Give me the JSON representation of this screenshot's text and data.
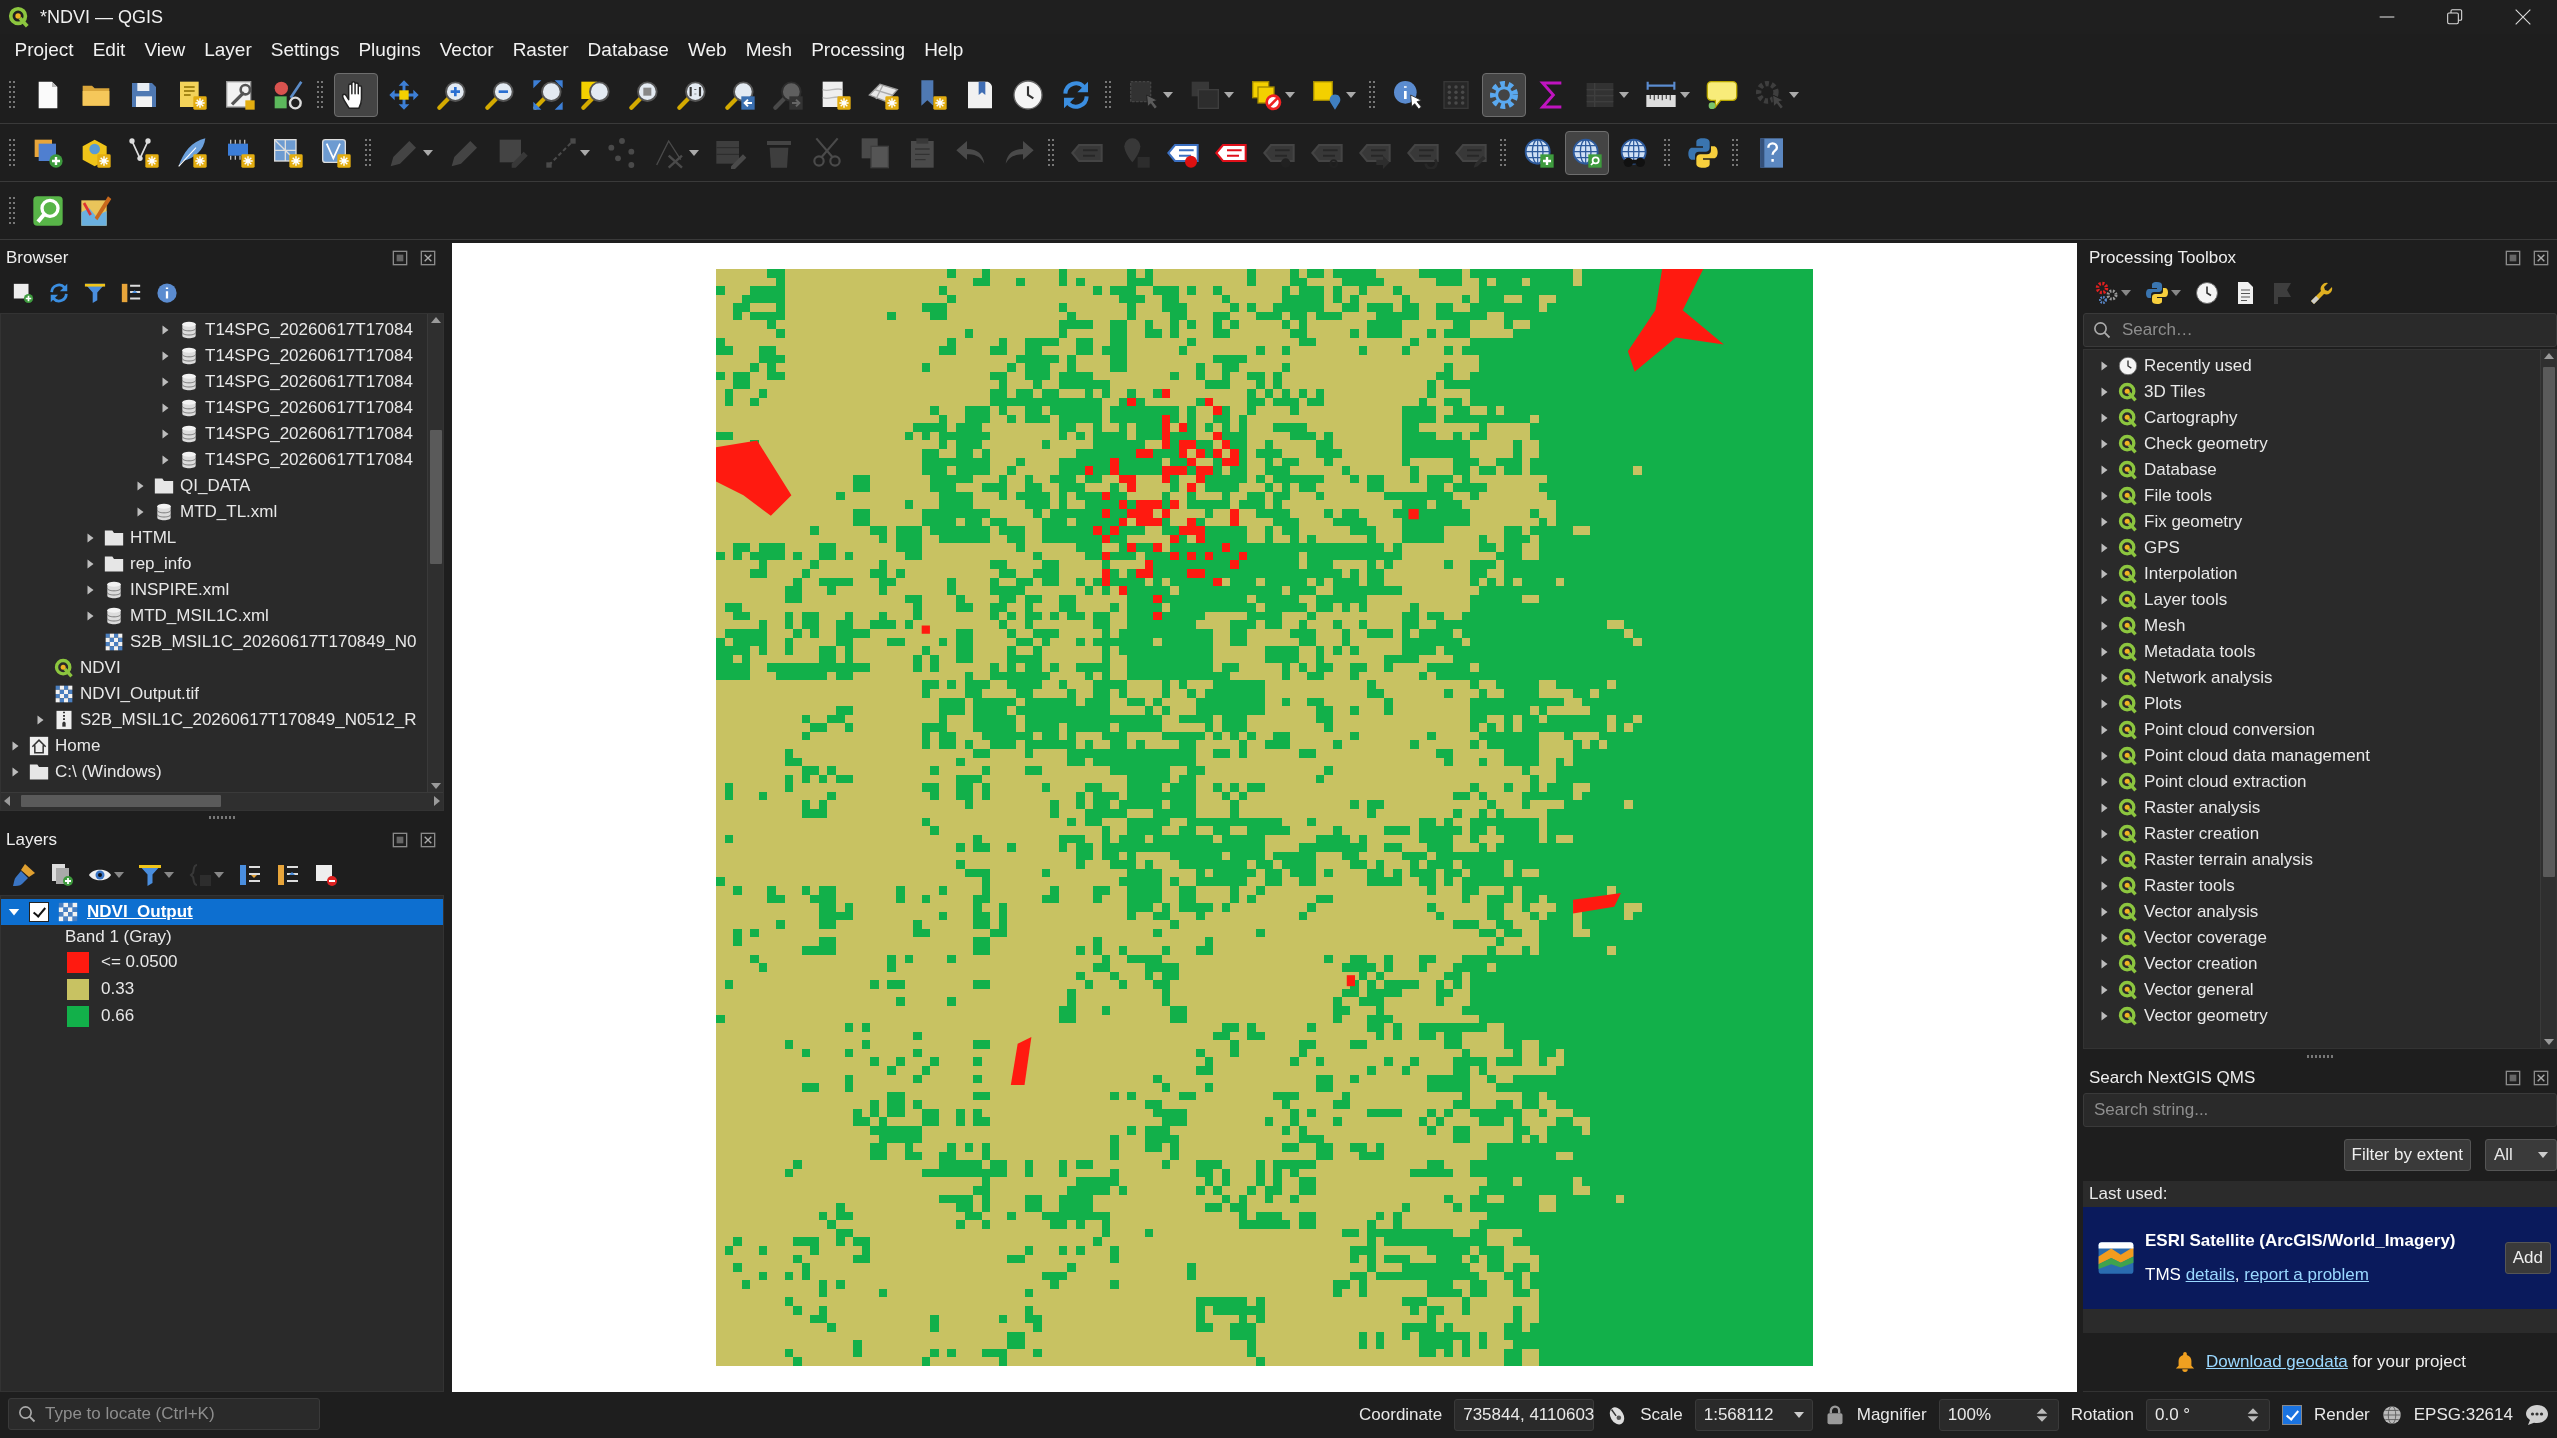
{
  "window": {
    "title": "*NDVI — QGIS"
  },
  "menu": [
    "Project",
    "Edit",
    "View",
    "Layer",
    "Settings",
    "Plugins",
    "Vector",
    "Raster",
    "Database",
    "Web",
    "Mesh",
    "Processing",
    "Help"
  ],
  "toolbars": [
    {
      "groups": [
        [
          {
            "on": false,
            "disabled": false
          },
          {
            "on": false,
            "disabled": false
          },
          {
            "on": false,
            "disabled": false
          },
          {
            "on": false,
            "disabled": false
          },
          {
            "on": false,
            "disabled": false
          },
          {
            "on": false,
            "disabled": false
          }
        ],
        [
          {
            "on": true,
            "disabled": false
          },
          {
            "on": false,
            "disabled": false
          },
          {
            "on": false,
            "disabled": false
          },
          {
            "on": false,
            "disabled": false
          },
          {
            "on": false,
            "disabled": false
          },
          {
            "on": false,
            "disabled": false
          },
          {
            "on": false,
            "disabled": false
          },
          {
            "on": false,
            "disabled": false
          },
          {
            "on": false,
            "disabled": false
          },
          {
            "on": false,
            "disabled": true
          },
          {
            "on": false,
            "disabled": false
          },
          {
            "on": false,
            "disabled": false
          },
          {
            "on": false,
            "disabled": false
          },
          {
            "on": false,
            "disabled": false
          },
          {
            "on": false,
            "disabled": false
          },
          {
            "on": false,
            "disabled": false
          }
        ],
        [
          {
            "on": false,
            "disabled": true
          },
          {
            "on": false,
            "disabled": true
          },
          {
            "on": false,
            "disabled": false
          },
          {
            "on": false,
            "disabled": false
          }
        ],
        [
          {
            "on": false,
            "disabled": false
          },
          {
            "on": false,
            "disabled": true
          },
          {
            "on": true,
            "disabled": false
          },
          {
            "on": false,
            "disabled": false
          },
          {
            "on": false,
            "disabled": true
          },
          {
            "on": false,
            "disabled": false
          },
          {
            "on": false,
            "disabled": false
          },
          {
            "on": false,
            "disabled": true
          }
        ]
      ]
    },
    {
      "groups": [
        [
          {
            "on": false,
            "disabled": false
          },
          {
            "on": false,
            "disabled": false
          },
          {
            "on": false,
            "disabled": false
          },
          {
            "on": false,
            "disabled": false
          },
          {
            "on": false,
            "disabled": false
          },
          {
            "on": false,
            "disabled": false
          },
          {
            "on": false,
            "disabled": false
          }
        ],
        [
          {
            "on": false,
            "disabled": true
          },
          {
            "on": false,
            "disabled": true
          },
          {
            "on": false,
            "disabled": true
          },
          {
            "on": false,
            "disabled": true
          },
          {
            "on": false,
            "disabled": true
          },
          {
            "on": false,
            "disabled": true
          },
          {
            "on": false,
            "disabled": true
          },
          {
            "on": false,
            "disabled": true
          },
          {
            "on": false,
            "disabled": true
          },
          {
            "on": false,
            "disabled": true
          },
          {
            "on": false,
            "disabled": true
          },
          {
            "on": false,
            "disabled": true
          },
          {
            "on": false,
            "disabled": true
          }
        ],
        [
          {
            "on": false,
            "disabled": true
          },
          {
            "on": false,
            "disabled": true
          },
          {
            "on": false,
            "disabled": false
          },
          {
            "on": false,
            "disabled": false
          },
          {
            "on": false,
            "disabled": true
          },
          {
            "on": false,
            "disabled": true
          },
          {
            "on": false,
            "disabled": true
          },
          {
            "on": false,
            "disabled": true
          },
          {
            "on": false,
            "disabled": true
          }
        ],
        [
          {
            "on": false,
            "disabled": false
          },
          {
            "on": true,
            "disabled": false
          },
          {
            "on": false,
            "disabled": false
          }
        ],
        [
          {
            "on": false,
            "disabled": false
          }
        ],
        [
          {
            "on": false,
            "disabled": false
          }
        ]
      ]
    },
    {
      "groups": [
        [
          {
            "on": false,
            "disabled": false
          },
          {
            "on": false,
            "disabled": false
          }
        ]
      ]
    }
  ],
  "browser": {
    "title": "Browser",
    "tree": [
      {
        "children": [
          {
            "children": [
              {
                "children": [
                  {
                    "children": [
                      {
                        "children": [
                          {
                            "children": [
                              {
                                "label": "T14SPG_20260617T17084",
                                "kind": "database",
                                "expandable": true
                              },
                              {
                                "label": "T14SPG_20260617T17084",
                                "kind": "database",
                                "expandable": true
                              },
                              {
                                "label": "T14SPG_20260617T17084",
                                "kind": "database",
                                "expandable": true
                              },
                              {
                                "label": "T14SPG_20260617T17084",
                                "kind": "database",
                                "expandable": true
                              },
                              {
                                "label": "T14SPG_20260617T17084",
                                "kind": "database",
                                "expandable": true
                              },
                              {
                                "label": "T14SPG_20260617T17084",
                                "kind": "database",
                                "expandable": true
                              }
                            ]
                          },
                          {
                            "label": "QI_DATA",
                            "kind": "folder",
                            "expandable": true
                          },
                          {
                            "label": "MTD_TL.xml",
                            "kind": "database",
                            "expandable": true
                          }
                        ]
                      }
                    ]
                  },
                  {
                    "label": "HTML",
                    "kind": "folder",
                    "expandable": true
                  },
                  {
                    "label": "rep_info",
                    "kind": "folder",
                    "expandable": true
                  },
                  {
                    "label": "INSPIRE.xml",
                    "kind": "database",
                    "expandable": true
                  },
                  {
                    "label": "MTD_MSIL1C.xml",
                    "kind": "database",
                    "expandable": true
                  },
                  {
                    "label": "S2B_MSIL1C_20260617T170849_N0",
                    "kind": "raster",
                    "expandable": false
                  }
                ]
              }
            ]
          },
          {
            "label": "NDVI",
            "kind": "project",
            "expandable": false
          },
          {
            "label": "NDVI_Output.tif",
            "kind": "raster",
            "expandable": false
          },
          {
            "label": "S2B_MSIL1C_20260617T170849_N0512_R",
            "kind": "zip",
            "expandable": true
          }
        ]
      },
      {
        "label": "Home",
        "kind": "home",
        "expandable": true
      },
      {
        "label": "C:\\ (Windows)",
        "kind": "folder",
        "expandable": true
      }
    ]
  },
  "layers": {
    "title": "Layers",
    "toolbar": [
      {
        "disabled": false
      },
      {
        "disabled": false
      },
      {
        "disabled": false
      },
      {
        "disabled": false
      },
      {
        "disabled": true
      },
      {
        "disabled": false
      },
      {
        "disabled": false
      },
      {
        "disabled": false
      }
    ],
    "items": [
      {
        "label": "NDVI_Output",
        "selected": true,
        "checked": true,
        "expanded": true,
        "band": "Band 1 (Gray)",
        "legend": [
          {
            "label": "<= 0.0500",
            "color": "#ff1a10"
          },
          {
            "label": "0.33",
            "color": "#c8c262"
          },
          {
            "label": "0.66",
            "color": "#12b04a"
          }
        ]
      }
    ]
  },
  "processing": {
    "title": "Processing Toolbox",
    "toolbar": [
      {
        "disabled": false
      },
      {
        "disabled": false
      },
      {
        "disabled": false
      },
      {
        "disabled": false
      },
      {
        "disabled": true
      },
      {
        "disabled": false
      }
    ],
    "search": {
      "placeholder": "Search…"
    },
    "items": [
      {
        "label": "Recently used",
        "kind": "recent"
      },
      {
        "label": "3D Tiles",
        "kind": "provider"
      },
      {
        "label": "Cartography",
        "kind": "provider"
      },
      {
        "label": "Check geometry",
        "kind": "provider"
      },
      {
        "label": "Database",
        "kind": "provider"
      },
      {
        "label": "File tools",
        "kind": "provider"
      },
      {
        "label": "Fix geometry",
        "kind": "provider"
      },
      {
        "label": "GPS",
        "kind": "provider"
      },
      {
        "label": "Interpolation",
        "kind": "provider"
      },
      {
        "label": "Layer tools",
        "kind": "provider"
      },
      {
        "label": "Mesh",
        "kind": "provider"
      },
      {
        "label": "Metadata tools",
        "kind": "provider"
      },
      {
        "label": "Network analysis",
        "kind": "provider"
      },
      {
        "label": "Plots",
        "kind": "provider"
      },
      {
        "label": "Point cloud conversion",
        "kind": "provider"
      },
      {
        "label": "Point cloud data management",
        "kind": "provider"
      },
      {
        "label": "Point cloud extraction",
        "kind": "provider"
      },
      {
        "label": "Raster analysis",
        "kind": "provider"
      },
      {
        "label": "Raster creation",
        "kind": "provider"
      },
      {
        "label": "Raster terrain analysis",
        "kind": "provider"
      },
      {
        "label": "Raster tools",
        "kind": "provider"
      },
      {
        "label": "Vector analysis",
        "kind": "provider"
      },
      {
        "label": "Vector coverage",
        "kind": "provider"
      },
      {
        "label": "Vector creation",
        "kind": "provider"
      },
      {
        "label": "Vector general",
        "kind": "provider"
      },
      {
        "label": "Vector geometry",
        "kind": "provider"
      }
    ]
  },
  "qms": {
    "title": "Search NextGIS QMS",
    "search": {
      "placeholder": "Search string..."
    },
    "filter_button": "Filter by extent",
    "filter_select": "All",
    "last_used_label": "Last used:",
    "service": {
      "name": "ESRI Satellite (ArcGIS/World_Imagery)",
      "type": "TMS",
      "links": [
        "details",
        "report a problem"
      ],
      "separator": ",",
      "button": "Add"
    },
    "download": {
      "link": "Download geodata",
      "text": "for your project"
    }
  },
  "status_bar": {
    "locate": {
      "placeholder": "Type to locate (Ctrl+K)"
    },
    "coordinate_label": "Coordinate",
    "coordinate": "735844, 4110603",
    "scale_label": "Scale",
    "scale": "1:568112",
    "magnifier_label": "Magnifier",
    "magnifier": "100%",
    "rotation_label": "Rotation",
    "rotation": "0.0 °",
    "render": {
      "label": "Render",
      "checked": true
    },
    "crs": "EPSG:32614"
  }
}
